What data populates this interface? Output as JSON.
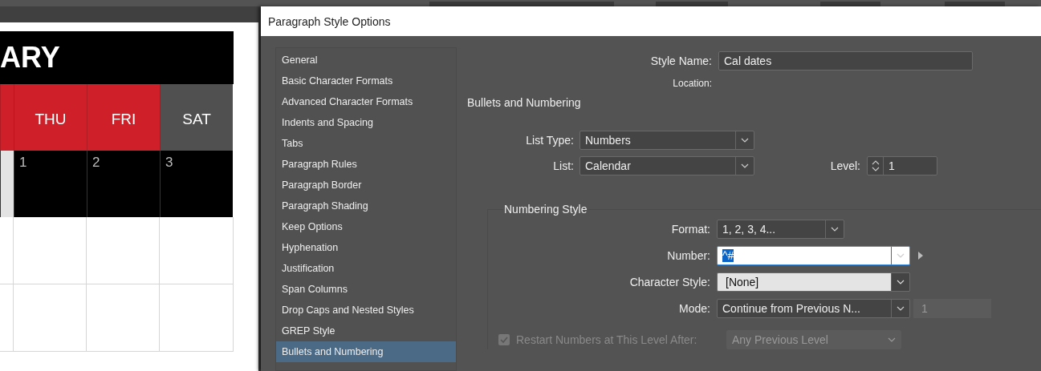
{
  "calendar": {
    "month": "ARY",
    "weekdays": [
      {
        "label": "THU",
        "kind": "weekday"
      },
      {
        "label": "FRI",
        "kind": "weekday"
      },
      {
        "label": "SAT",
        "kind": "weekend"
      }
    ],
    "dates": [
      "1",
      "2",
      "3"
    ]
  },
  "dialog": {
    "title": "Paragraph Style Options",
    "categories": [
      {
        "label": "General",
        "selected": false
      },
      {
        "label": "Basic Character Formats",
        "selected": false
      },
      {
        "label": "Advanced Character Formats",
        "selected": false
      },
      {
        "label": "Indents and Spacing",
        "selected": false
      },
      {
        "label": "Tabs",
        "selected": false
      },
      {
        "label": "Paragraph Rules",
        "selected": false
      },
      {
        "label": "Paragraph Border",
        "selected": false
      },
      {
        "label": "Paragraph Shading",
        "selected": false
      },
      {
        "label": "Keep Options",
        "selected": false
      },
      {
        "label": "Hyphenation",
        "selected": false
      },
      {
        "label": "Justification",
        "selected": false
      },
      {
        "label": "Span Columns",
        "selected": false
      },
      {
        "label": "Drop Caps and Nested Styles",
        "selected": false
      },
      {
        "label": "GREP Style",
        "selected": false
      },
      {
        "label": "Bullets and Numbering",
        "selected": true
      }
    ],
    "style_name": {
      "label": "Style Name:",
      "value": "Cal dates"
    },
    "location": {
      "label": "Location:"
    },
    "section": "Bullets and Numbering",
    "list_type": {
      "label": "List Type:",
      "value": "Numbers"
    },
    "list": {
      "label": "List:",
      "value": "Calendar"
    },
    "level": {
      "label": "Level:",
      "value": "1"
    },
    "numbering_style": {
      "title": "Numbering Style",
      "format": {
        "label": "Format:",
        "value": "1, 2, 3, 4..."
      },
      "number": {
        "label": "Number:",
        "value": "^#"
      },
      "character_style": {
        "label": "Character Style:",
        "value": "[None]"
      },
      "mode": {
        "label": "Mode:",
        "value": "Continue from Previous N...",
        "start": "1"
      },
      "restart": {
        "label": "Restart Numbers at This Level After:",
        "checked": true,
        "disabled": true,
        "value": "Any Previous Level"
      }
    }
  }
}
